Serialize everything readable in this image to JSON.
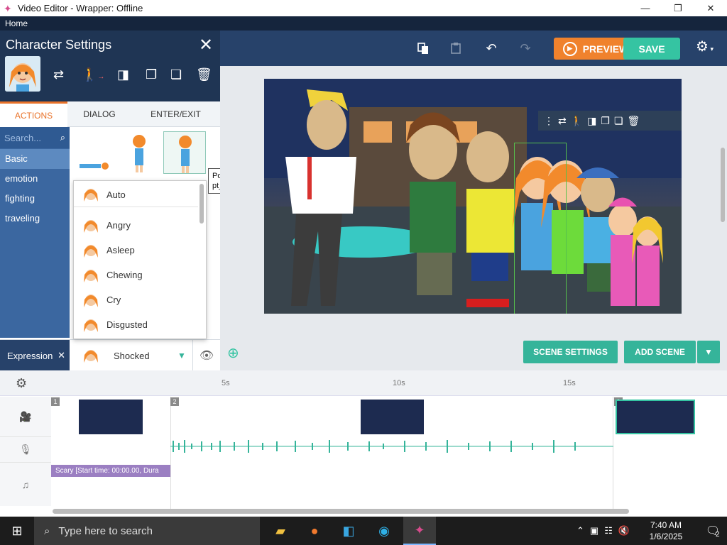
{
  "window": {
    "title": "Video Editor - Wrapper: Offline",
    "menu_home": "Home",
    "min": "—",
    "max": "❐",
    "close": "✕"
  },
  "toolbar": {
    "preview_label": "PREVIEW",
    "save_label": "SAVE"
  },
  "panel": {
    "title": "Character Settings",
    "tabs": [
      "ACTIONS",
      "DIALOG",
      "ENTER/EXIT"
    ],
    "search_placeholder": "Search...",
    "categories": [
      "Basic",
      "emotion",
      "fighting",
      "traveling"
    ],
    "expression_label": "Expression",
    "expression_value": "Shocked"
  },
  "dropdown": {
    "items": [
      "Auto",
      "Angry",
      "Asleep",
      "Chewing",
      "Cry",
      "Disgusted"
    ]
  },
  "tooltip": {
    "line1": "Point at",
    "line2": "pt_at.xml"
  },
  "stage": {
    "scene_settings": "SCENE SETTINGS",
    "add_scene": "ADD SCENE"
  },
  "timeline": {
    "ticks": [
      "5s",
      "10s",
      "15s"
    ],
    "scene_numbers": [
      "1",
      "2",
      "3"
    ],
    "music_clip": "Scary [Start time: 00:00.00, Dura"
  },
  "taskbar": {
    "search_text": "Type here to search",
    "time": "7:40 AM",
    "date": "1/6/2025",
    "notifications": "2"
  },
  "colors": {
    "accent_orange": "#f0822d",
    "accent_teal": "#35c4a2",
    "panel_blue": "#1f3554",
    "toolbar_blue": "#27426a"
  }
}
